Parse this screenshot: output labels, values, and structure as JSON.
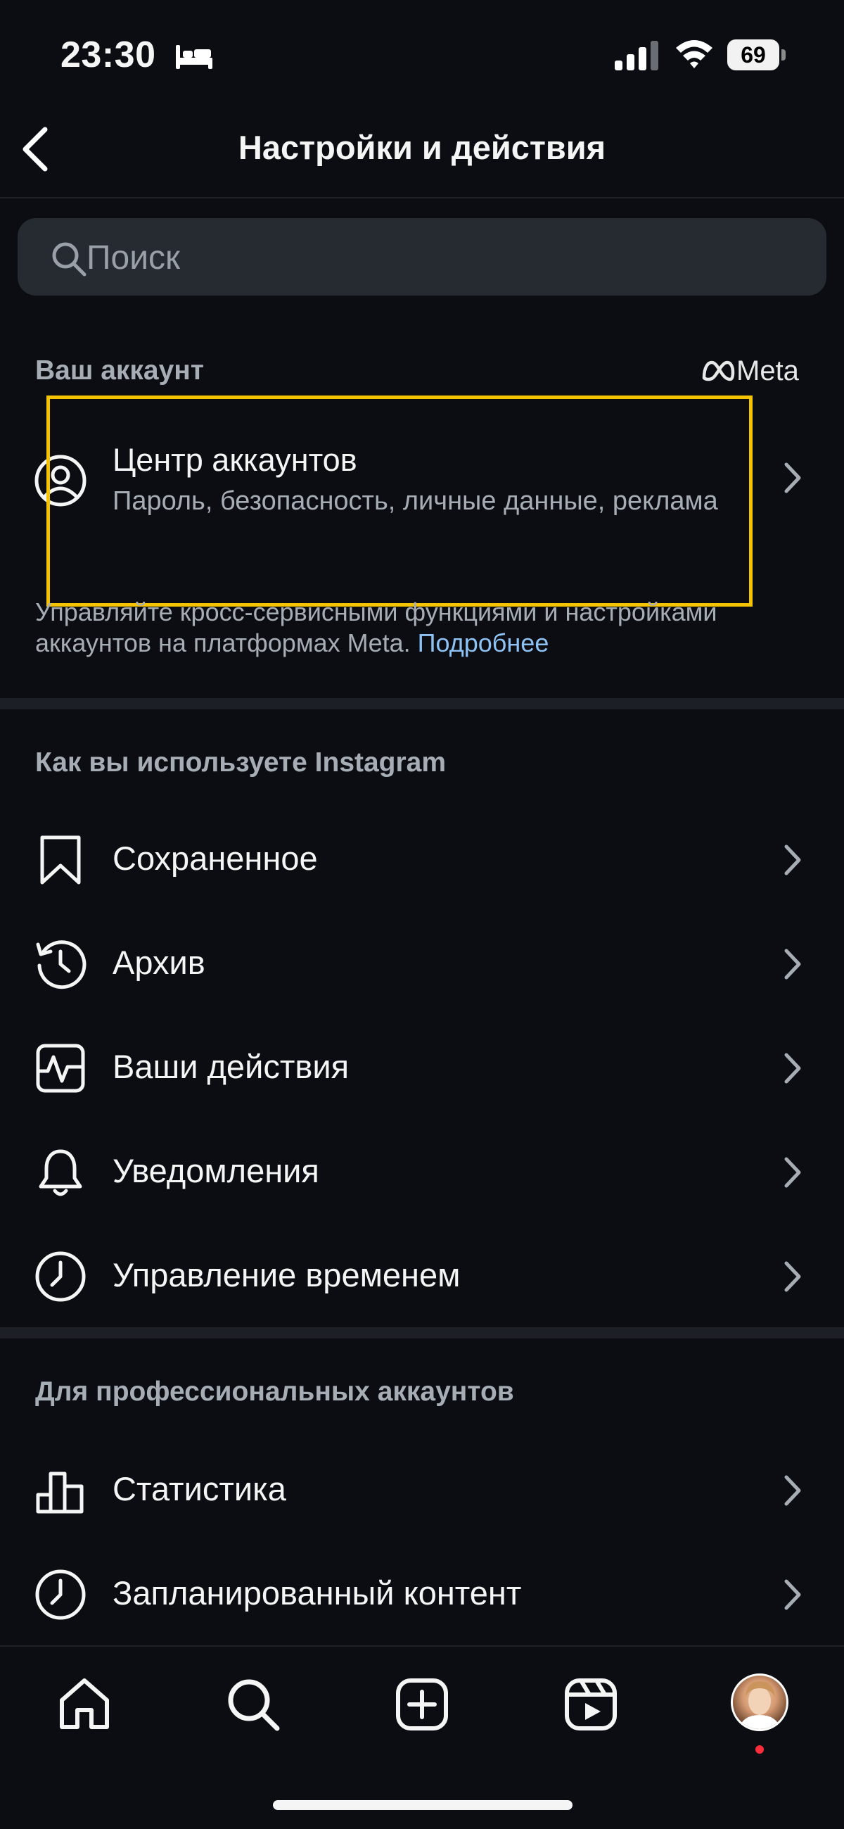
{
  "status_bar": {
    "time": "23:30",
    "battery": "69"
  },
  "header": {
    "title": "Настройки и действия"
  },
  "search": {
    "placeholder": "Поиск"
  },
  "account_section": {
    "title": "Ваш аккаунт",
    "meta_logo_text": "Meta",
    "accounts_center": {
      "title": "Центр аккаунтов",
      "subtitle": "Пароль, безопасность, личные данные, реклама"
    },
    "description": "Управляйте кросс-сервисными функциями и настройками аккаунтов на платформах Meta. ",
    "learn_more": "Подробнее"
  },
  "usage_section": {
    "title": "Как вы используете Instagram",
    "items": [
      {
        "label": "Сохраненное",
        "icon": "bookmark-icon"
      },
      {
        "label": "Архив",
        "icon": "archive-icon"
      },
      {
        "label": "Ваши действия",
        "icon": "activity-icon"
      },
      {
        "label": "Уведомления",
        "icon": "bell-icon"
      },
      {
        "label": "Управление временем",
        "icon": "clock-icon"
      }
    ]
  },
  "pro_section": {
    "title": "Для профессиональных аккаунтов",
    "items": [
      {
        "label": "Статистика",
        "icon": "insights-icon"
      },
      {
        "label": "Запланированный контент",
        "icon": "clock-icon"
      }
    ]
  },
  "bottom_nav": {
    "items": [
      "home-icon",
      "search-icon",
      "create-icon",
      "reels-icon",
      "profile-avatar"
    ]
  },
  "colors": {
    "background": "#0b0d12",
    "highlight": "#f5c400",
    "link": "#8ec2f4",
    "notification_dot": "#ff2d3c"
  }
}
